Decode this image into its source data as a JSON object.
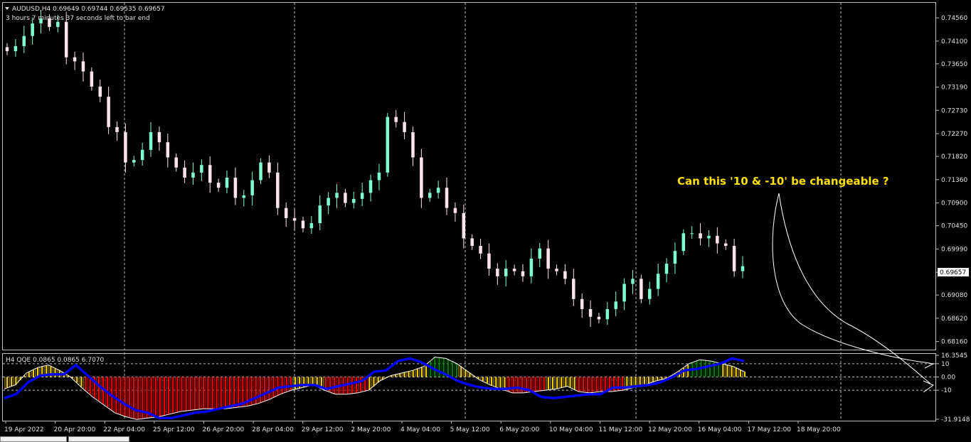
{
  "header": {
    "symbol_info": "AUDUSD,H4  0.69649 0.69744 0.69535 0.69657",
    "timer": "3 hours 7 minutes 37 seconds left to bar end",
    "indicator_info": "H4 QQE 0.0865 0.0865 6.7070"
  },
  "annotation": {
    "text": "Can this '10 & -10' be changeable ?"
  },
  "colors": {
    "background": "#000000",
    "bull_candle": "#7fffd4",
    "bear_candle": "#ffe4ee",
    "grid": "#c0c0c0",
    "qqe_red": "#ff0000",
    "qqe_yellow": "#ffd700",
    "qqe_green": "#008000",
    "qqe_line": "#0000ff",
    "annotation": "#ffe000"
  },
  "chart_data": [
    {
      "type": "candlestick",
      "title": "AUDUSD,H4",
      "ylim": [
        0.68,
        0.748
      ],
      "price_ticks": [
        "0.74560",
        "0.74100",
        "0.73650",
        "0.73190",
        "0.72730",
        "0.72270",
        "0.71820",
        "0.71360",
        "0.70900",
        "0.70450",
        "0.69990",
        "0.69530",
        "0.69080",
        "0.68620",
        "0.68160"
      ],
      "current_price": "0.69657",
      "x_tick_labels": [
        "19 Apr 2022",
        "20 Apr 20:00",
        "22 Apr 04:00",
        "25 Apr 12:00",
        "26 Apr 20:00",
        "28 Apr 04:00",
        "29 Apr 12:00",
        "2 May 20:00",
        "4 May 04:00",
        "5 May 12:00",
        "6 May 20:00",
        "10 May 04:00",
        "11 May 12:00",
        "12 May 20:00",
        "16 May 04:00",
        "17 May 12:00",
        "18 May 20:00"
      ],
      "close_path": [
        0.739,
        0.74,
        0.742,
        0.7445,
        0.7455,
        0.7438,
        0.7448,
        0.7378,
        0.737,
        0.735,
        0.732,
        0.73,
        0.724,
        0.723,
        0.717,
        0.7175,
        0.7195,
        0.723,
        0.721,
        0.718,
        0.716,
        0.714,
        0.715,
        0.7165,
        0.713,
        0.712,
        0.714,
        0.71,
        0.7105,
        0.7135,
        0.717,
        0.715,
        0.708,
        0.706,
        0.7055,
        0.704,
        0.705,
        0.7085,
        0.71,
        0.711,
        0.709,
        0.7098,
        0.711,
        0.7135,
        0.715,
        0.726,
        0.725,
        0.723,
        0.718,
        0.71,
        0.711,
        0.712,
        0.708,
        0.707,
        0.702,
        0.7005,
        0.699,
        0.696,
        0.6945,
        0.696,
        0.6955,
        0.6945,
        0.698,
        0.7,
        0.696,
        0.6955,
        0.694,
        0.69,
        0.688,
        0.6865,
        0.686,
        0.688,
        0.6895,
        0.693,
        0.694,
        0.69,
        0.692,
        0.695,
        0.697,
        0.6995,
        0.703,
        0.703,
        0.702,
        0.7025,
        0.701,
        0.7005,
        0.6955,
        0.6965
      ]
    },
    {
      "type": "bar",
      "title": "H4 QQE",
      "ylim": [
        -31.9148,
        16.3545
      ],
      "value_ticks": [
        "16.3545",
        "10",
        "0.00",
        "-10",
        "-31.9148"
      ],
      "levels": [
        10,
        0,
        -10
      ],
      "histogram_path": [
        -9,
        -6,
        3,
        7,
        9,
        5,
        0,
        -8,
        -15,
        -21,
        -27,
        -30,
        -32,
        -31,
        -30,
        -28,
        -26,
        -25,
        -24,
        -24,
        -24,
        -23,
        -22,
        -20,
        -17,
        -13,
        -10,
        -8,
        -6,
        -10,
        -13,
        -13,
        -12,
        -10,
        -3,
        1,
        3,
        5,
        8,
        15,
        14,
        10,
        4,
        -2,
        -6,
        -9,
        -12,
        -12,
        -11,
        -10,
        -9,
        -7,
        -11,
        -12,
        -11,
        -11,
        -10,
        -8,
        -6,
        -3,
        -1,
        4,
        10,
        13,
        12,
        10,
        8,
        4
      ],
      "blue_line_path": [
        -16,
        -13,
        -4,
        1,
        2,
        2,
        9,
        1,
        -7,
        -14,
        -20,
        -25,
        -27,
        -31,
        -31,
        -29,
        -27,
        -26,
        -24,
        -22,
        -20,
        -16,
        -12,
        -8,
        -7,
        -6,
        -6,
        -9,
        -7,
        -5,
        -3,
        4,
        5,
        12,
        14,
        11,
        6,
        2,
        -3,
        -6,
        -8,
        -9,
        -9,
        -8,
        -10,
        -15,
        -16,
        -15,
        -14,
        -13,
        -13,
        -8,
        -8,
        -7,
        -6,
        -4,
        0,
        5,
        6,
        8,
        10,
        14,
        12
      ],
      "series": [
        {
          "name": "QQE histogram"
        },
        {
          "name": "QQE line"
        }
      ]
    }
  ]
}
